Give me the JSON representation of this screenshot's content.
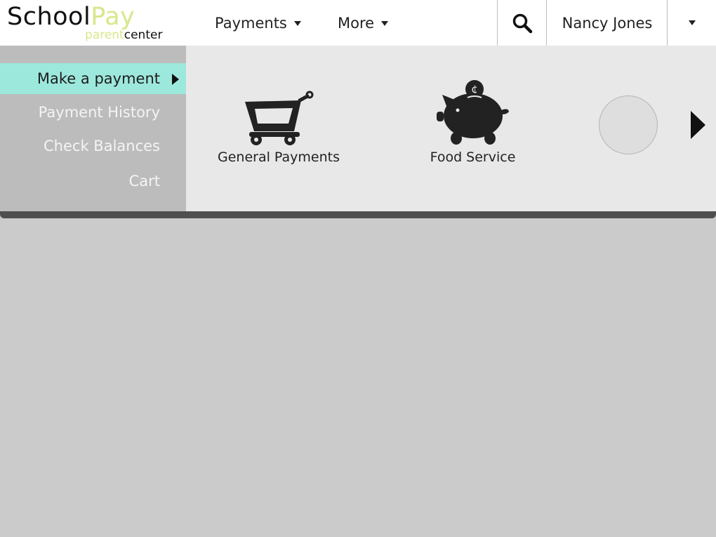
{
  "logo": {
    "school": "School",
    "pay": "Pay",
    "parent": "parent",
    "center": "center"
  },
  "nav": {
    "payments": "Payments",
    "more": "More"
  },
  "user": {
    "name": "Nancy Jones"
  },
  "side_menu": {
    "items": [
      {
        "label": "Make a payment"
      },
      {
        "label": "Payment History"
      },
      {
        "label": "Check Balances"
      },
      {
        "label": "Cart"
      }
    ]
  },
  "tiles": [
    {
      "label": "General Payments",
      "icon": "shopping-cart-icon"
    },
    {
      "label": "Food Service",
      "icon": "piggy-bank-icon"
    }
  ],
  "colors": {
    "active_item": "#9de8dc",
    "logo_accent": "#d6e88a",
    "panel_bg": "#e8e8e8",
    "menu_bg": "#bcbcbc",
    "page_bg": "#cbcbcb"
  }
}
